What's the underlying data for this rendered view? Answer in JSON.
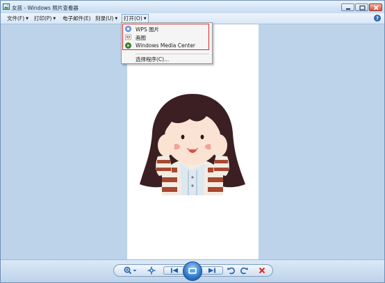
{
  "window": {
    "title": "女孩 - Windows 照片查看器",
    "app_icon": "photo-viewer-icon",
    "controls": [
      "minimize-icon",
      "maximize-icon",
      "close-icon"
    ]
  },
  "menubar": {
    "file": "文件(F)",
    "print": "打印(P)",
    "email": "电子邮件(E)",
    "burn": "刻录(U)",
    "open": "打开(O)",
    "help_icon": "help-icon"
  },
  "open_menu": {
    "items": [
      {
        "label": "WPS 图片",
        "icon": "wps-photo-icon"
      },
      {
        "label": "画图",
        "icon": "paint-icon"
      },
      {
        "label": "Windows Media Center",
        "icon": "media-center-icon"
      }
    ],
    "choose_program": "选择程序(C)...",
    "highlight_color": "#e0262a"
  },
  "toolbar": {
    "buttons": [
      "zoom-icon",
      "actual-size-icon",
      "previous-icon",
      "slideshow-icon",
      "next-icon",
      "rotate-ccw-icon",
      "rotate-cw-icon",
      "delete-icon"
    ]
  },
  "colors": {
    "frame_bg": "#bcd3ea",
    "accent": "#2f78c9",
    "delete_red": "#d9261c"
  }
}
